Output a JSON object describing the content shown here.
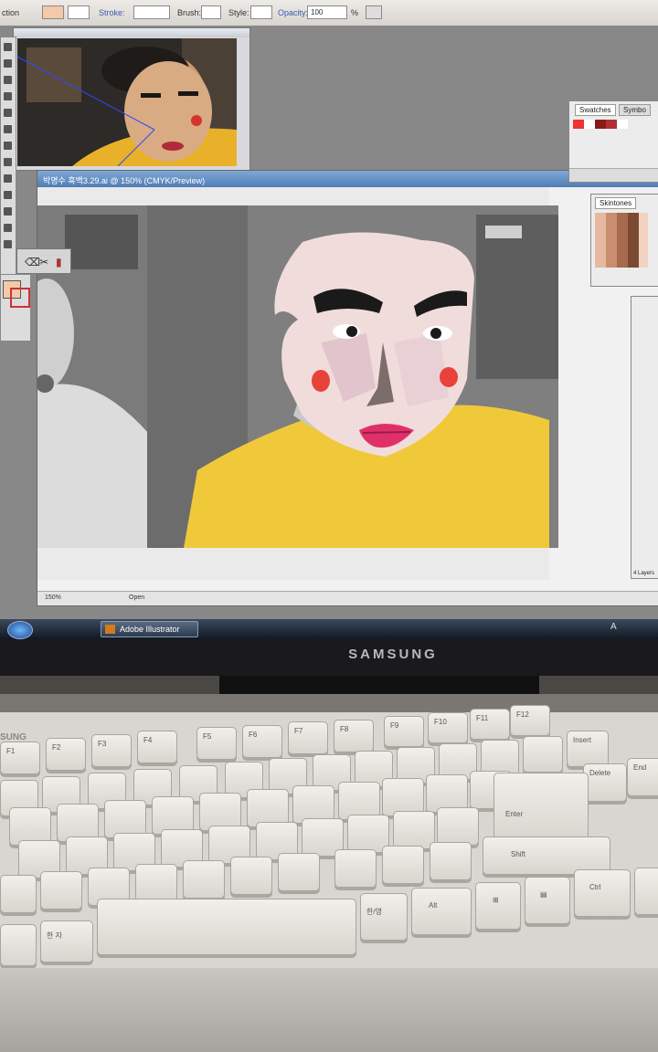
{
  "controlbar": {
    "left_label": "ction",
    "stroke_label": "Stroke:",
    "brush_label": "Brush:",
    "style_label": "Style:",
    "opacity_label": "Opacity:",
    "opacity_value": "100",
    "percent": "%"
  },
  "document": {
    "title": "박명수 흑백3.29.ai @ 150% (CMYK/Preview)",
    "zoom": "150%",
    "status": "Open"
  },
  "panels": {
    "swatches_tab": "Swatches",
    "symbols_tab": "Symbo",
    "skintones_tab": "Skintones",
    "layers_count": "4 Layers"
  },
  "taskbar": {
    "app": "Adobe Illustrator",
    "tray_text": "A"
  },
  "monitor": {
    "brand": "SAMSUNG"
  },
  "keyboard": {
    "brand": "SUNG",
    "keys": {
      "f1": "F1",
      "f2": "F2",
      "f3": "F3",
      "f4": "F4",
      "f5": "F5",
      "f6": "F6",
      "f7": "F7",
      "f8": "F8",
      "f9": "F9",
      "f10": "F10",
      "f11": "F11",
      "f12": "F12",
      "enter": "Enter",
      "shift": "Shift",
      "ctrl": "Ctrl",
      "alt": "Alt",
      "delete": "Delete",
      "end": "End",
      "insert": "Insert",
      "hanja": "한 자",
      "hanyoung": "한/영"
    }
  },
  "colors": {
    "face": "#f1dcdc",
    "shirt": "#f0c93a",
    "cheek": "#e8423a",
    "lips": "#e0306a",
    "brow": "#1a1a1a"
  }
}
